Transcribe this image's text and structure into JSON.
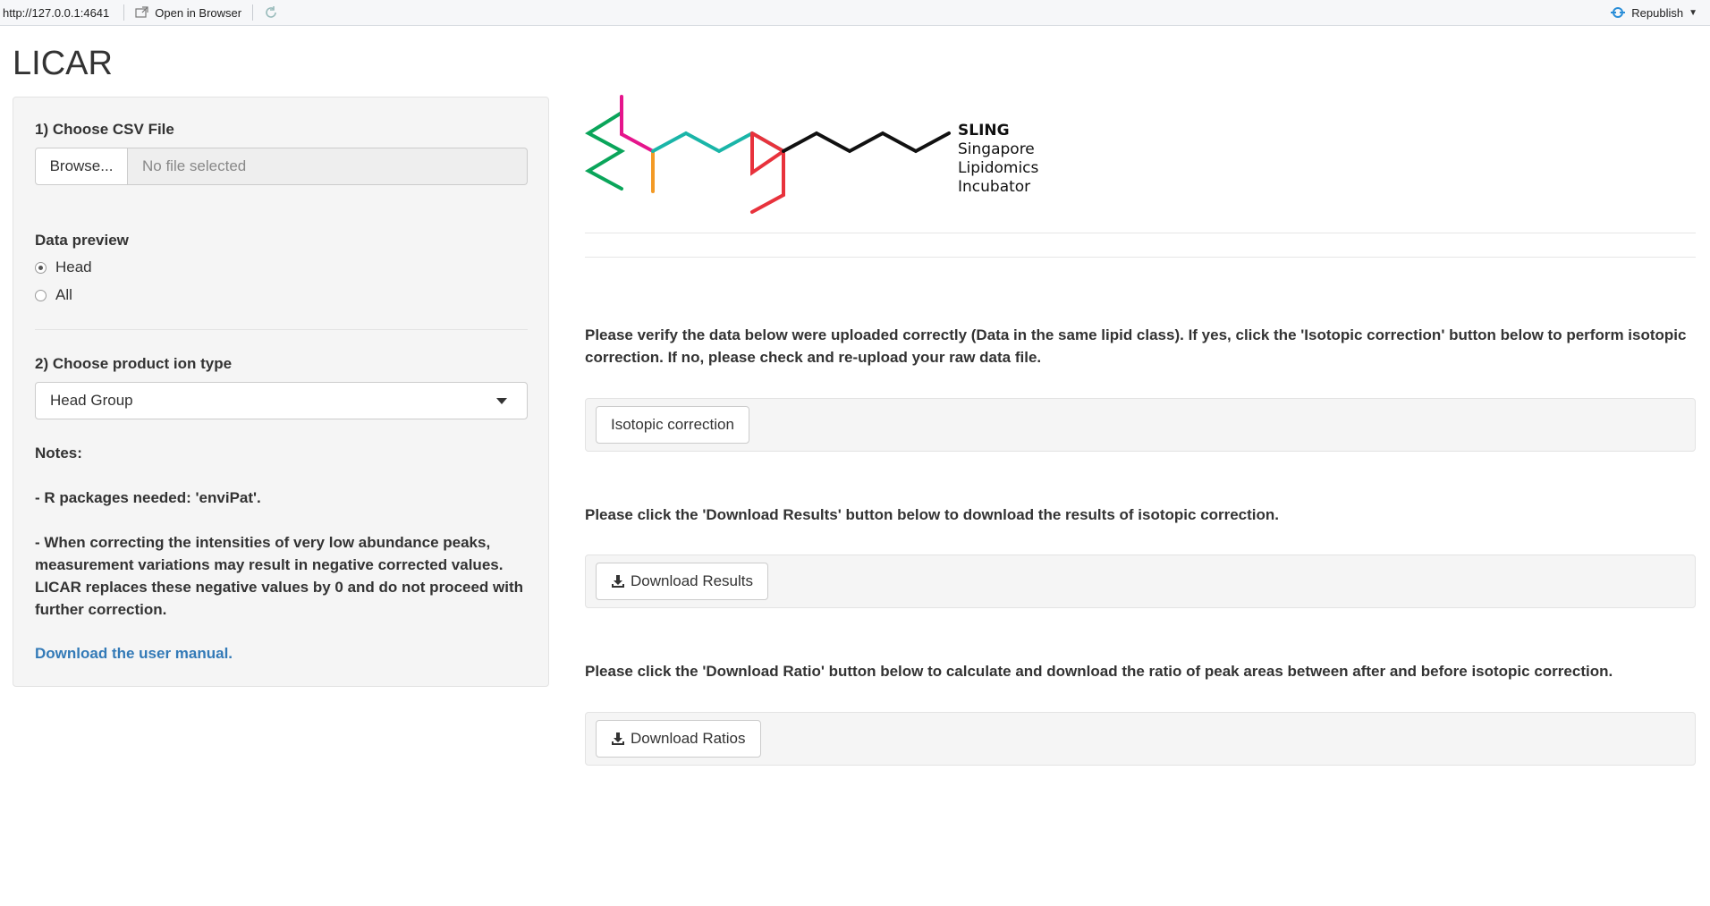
{
  "toolbar": {
    "url": "http://127.0.0.1:4641",
    "open_in_browser": "Open in Browser",
    "republish": "Republish"
  },
  "app": {
    "title": "LICAR"
  },
  "sidebar": {
    "file_label": "1) Choose CSV File",
    "browse_label": "Browse...",
    "file_placeholder": "No file selected",
    "preview_label": "Data preview",
    "preview_options": [
      {
        "label": "Head",
        "selected": true
      },
      {
        "label": "All",
        "selected": false
      }
    ],
    "ion_label": "2) Choose product ion type",
    "ion_selected": "Head Group",
    "notes": [
      "Notes:",
      "- R packages needed: 'enviPat'.",
      "- When correcting the intensities of very low abundance peaks, measurement variations may result in negative corrected values. LICAR replaces these negative values by 0 and do not proceed with further correction."
    ],
    "manual_link": "Download the user manual."
  },
  "logo": {
    "name": "SLING",
    "lines": [
      "Singapore",
      "Lipidomics",
      "Incubator"
    ],
    "colors": {
      "green": "#0aa55a",
      "magenta": "#e5158c",
      "orange": "#f39a25",
      "teal": "#1ab5a8",
      "red": "#e8323c",
      "black": "#111111"
    }
  },
  "main": {
    "verify_text": "Please verify the data below were uploaded correctly (Data in the same lipid class). If yes, click the 'Isotopic correction' button below to perform isotopic correction. If no, please check and re-upload your raw data file.",
    "correction_button": "Isotopic correction",
    "results_text": "Please click the 'Download Results' button below to download the results of isotopic correction.",
    "results_button": "Download Results",
    "ratio_text": "Please click the 'Download Ratio' button below to calculate and download the ratio of peak areas between after and before isotopic correction.",
    "ratio_button": "Download Ratios"
  },
  "colors": {
    "link": "#337ab7",
    "well_bg": "#f5f5f5",
    "republish_icon": "#2a8ed8"
  }
}
